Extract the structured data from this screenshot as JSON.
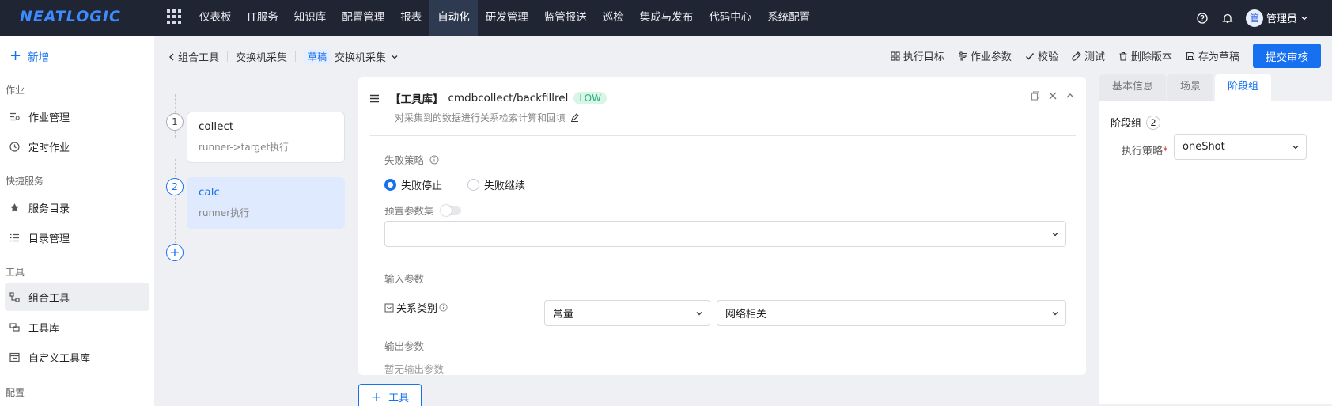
{
  "app": {
    "logo": "NEATLOGIC"
  },
  "topnav": {
    "items": [
      "仪表板",
      "IT服务",
      "知识库",
      "配置管理",
      "报表",
      "自动化",
      "研发管理",
      "监管报送",
      "巡检",
      "集成与发布",
      "代码中心",
      "系统配置"
    ],
    "active": "自动化"
  },
  "user": {
    "avatar": "管",
    "name": "管理员"
  },
  "sidebar": {
    "add_label": "新增",
    "groups": {
      "job": "作业",
      "quick": "快捷服务",
      "tool": "工具",
      "config": "配置"
    },
    "items": {
      "job_manage": "作业管理",
      "scheduled_job": "定时作业",
      "service_catalog": "服务目录",
      "catalog_manage": "目录管理",
      "combo_tool": "组合工具",
      "tool_library": "工具库",
      "custom_tool_library": "自定义工具库"
    },
    "active": "组合工具"
  },
  "breadcrumb": {
    "back": "组合工具",
    "name": "交换机采集",
    "status_badge": "草稿",
    "version": "交换机采集"
  },
  "toolbar": {
    "exec_target": "执行目标",
    "job_params": "作业参数",
    "validate": "校验",
    "test": "测试",
    "delete_version": "删除版本",
    "save_draft": "存为草稿",
    "submit": "提交审核"
  },
  "steps": [
    {
      "no": "1",
      "name": "collect",
      "desc": "runner->target执行",
      "active": false
    },
    {
      "no": "2",
      "name": "calc",
      "desc": "runner执行",
      "active": true
    }
  ],
  "tool_panel": {
    "lib_tag": "【工具库】",
    "tool_name": "cmdbcollect/backfillrel",
    "risk": "LOW",
    "description": "对采集到的数据进行关系检索计算和回填",
    "fail_policy_label": "失败策略",
    "fail_options": [
      "失败停止",
      "失败继续"
    ],
    "fail_selected": "失败停止",
    "preset_label": "预置参数集",
    "preset_value": "",
    "input_label": "输入参数",
    "input_params": [
      {
        "name": "关系类别",
        "mode": "常量",
        "value": "网络相关"
      }
    ],
    "output_label": "输出参数",
    "output_empty": "暂无输出参数"
  },
  "add_tool_label": "工具",
  "right_panel": {
    "tabs": [
      "基本信息",
      "场景",
      "阶段组"
    ],
    "active_tab": "阶段组",
    "group_label": "阶段组",
    "group_count": "2",
    "policy_label": "执行策略",
    "policy_value": "oneShot"
  },
  "colors": {
    "accent": "#1670f0",
    "topbar": "#1f2533",
    "low_badge_text": "#2ab27b"
  }
}
